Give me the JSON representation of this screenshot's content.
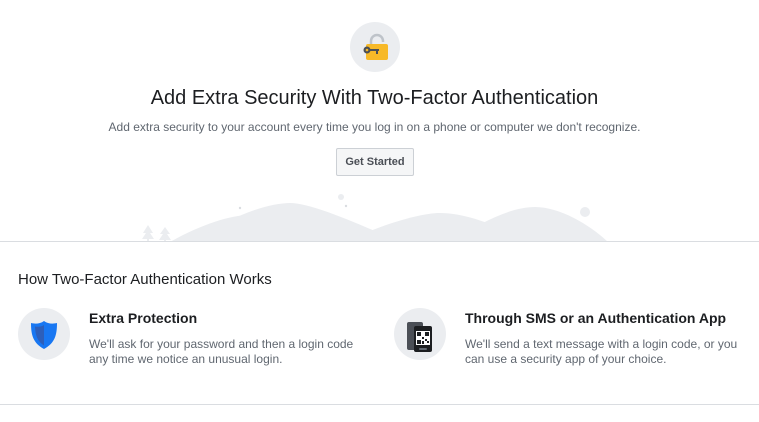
{
  "hero": {
    "icon": "padlock-key-icon",
    "title": "Add Extra Security With Two-Factor Authentication",
    "subtitle": "Add extra security to your account every time you log in on a phone or computer we don't recognize.",
    "button_label": "Get Started"
  },
  "how_it_works": {
    "title": "How Two-Factor Authentication Works",
    "features": [
      {
        "icon": "shield-icon",
        "title": "Extra Protection",
        "description": "We'll ask for your password and then a login code any time we notice an unusual login."
      },
      {
        "icon": "phone-qr-icon",
        "title": "Through SMS or an Authentication App",
        "description": "We'll send a text message with a login code, or you can use a security app of your choice."
      }
    ]
  },
  "colors": {
    "accent_gold": "#f7b928",
    "shield_blue": "#1877f2",
    "illustration_grey": "#ebedf0"
  }
}
